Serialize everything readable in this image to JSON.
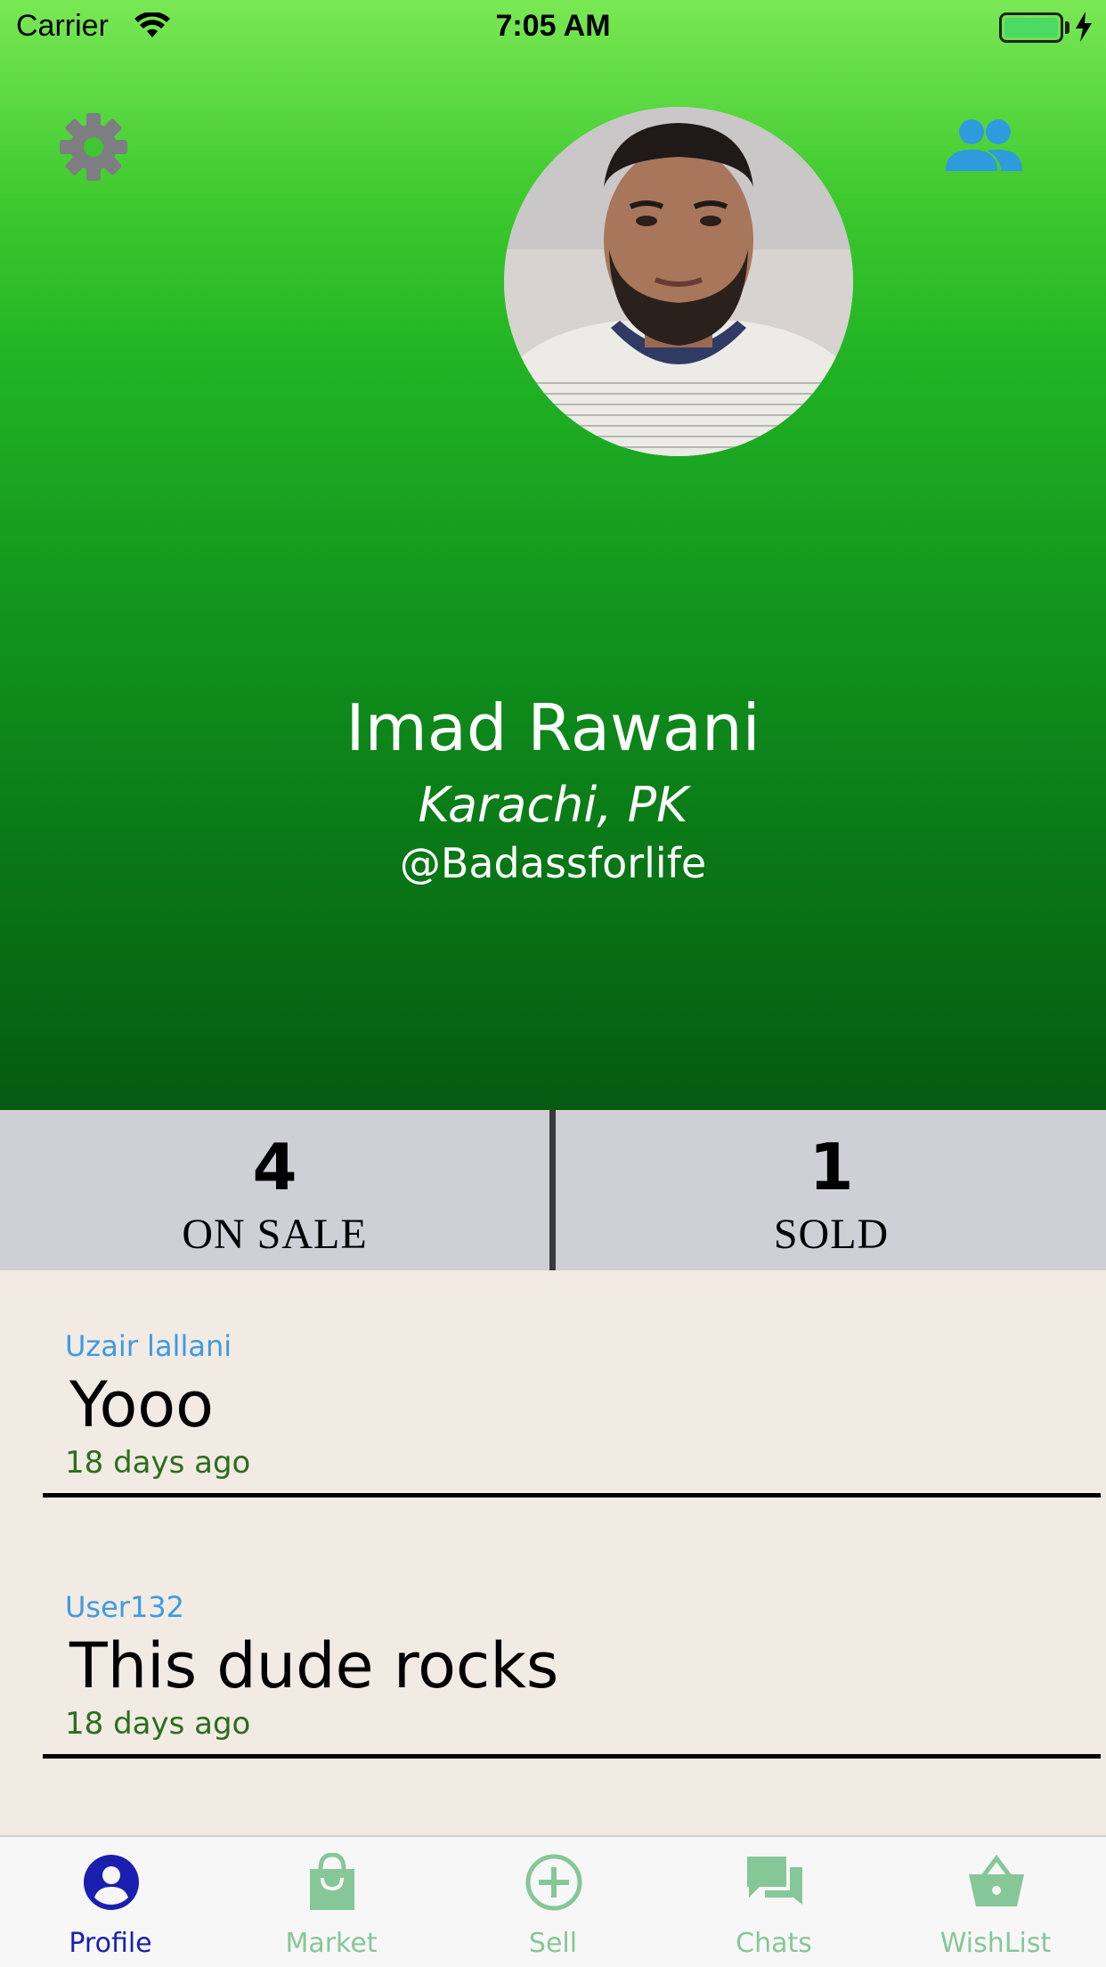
{
  "status_bar": {
    "carrier": "Carrier",
    "time": "7:05 AM"
  },
  "header": {
    "settings_icon": "gear-icon",
    "friends_icon": "people-icon"
  },
  "profile": {
    "name": "Imad Rawani",
    "location": "Karachi, PK",
    "handle": "@Badassforlife"
  },
  "stats": {
    "on_sale_count": "4",
    "on_sale_label": "ON SALE",
    "sold_count": "1",
    "sold_label": "SOLD"
  },
  "reviews": [
    {
      "user": "Uzair lallani",
      "text": "Yooo",
      "time": "18 days ago"
    },
    {
      "user": "User132",
      "text": "This dude rocks",
      "time": "18 days ago"
    }
  ],
  "tabs": [
    {
      "label": "Profile",
      "icon": "person-icon",
      "active": true
    },
    {
      "label": "Market",
      "icon": "bag-icon",
      "active": false
    },
    {
      "label": "Sell",
      "icon": "plus-circle-icon",
      "active": false
    },
    {
      "label": "Chats",
      "icon": "chat-icon",
      "active": false
    },
    {
      "label": "WishList",
      "icon": "basket-icon",
      "active": false
    }
  ],
  "colors": {
    "active_tab": "#1a1fb0",
    "inactive_tab": "#86c798",
    "review_user": "#3d9be0",
    "review_time": "#2b6e1e",
    "friends_icon": "#2e9bdc",
    "settings_icon": "#7d7d82"
  }
}
